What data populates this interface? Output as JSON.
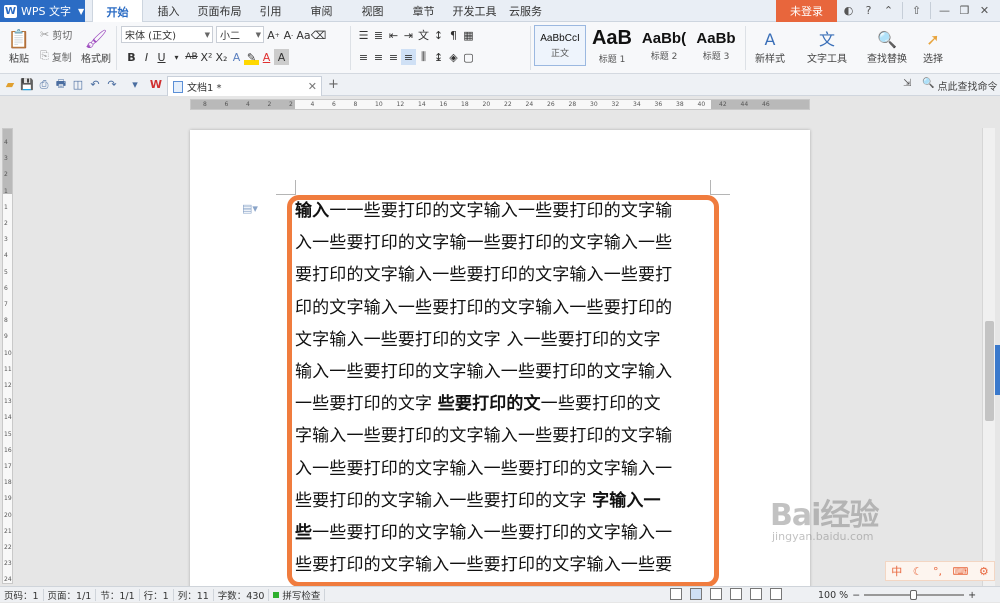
{
  "app": {
    "title": "WPS 文字"
  },
  "menu": {
    "tabs": [
      "开始",
      "插入",
      "页面布局",
      "引用",
      "审阅",
      "视图",
      "章节",
      "开发工具",
      "云服务"
    ],
    "active_index": 0,
    "login": "未登录"
  },
  "ribbon": {
    "paste": "粘贴",
    "cut": "剪切",
    "copy": "复制",
    "format_painter": "格式刷",
    "font_name": "宋体 (正文)",
    "font_size": "小二",
    "styles": [
      {
        "preview": "AaBbCcI",
        "name": "正文"
      },
      {
        "preview": "AaB",
        "name": "标题 1"
      },
      {
        "preview": "AaBb(",
        "name": "标题 2"
      },
      {
        "preview": "AaBb",
        "name": "标题 3"
      }
    ],
    "new_style": "新样式",
    "text_tools": "文字工具",
    "find_replace": "查找替换",
    "select": "选择"
  },
  "quickbar": {
    "doc_tab": "文档1 *",
    "find_command": "点此查找命令"
  },
  "ruler": {
    "h_ticks": [
      "8",
      "6",
      "4",
      "2",
      "2",
      "4",
      "6",
      "8",
      "10",
      "12",
      "14",
      "16",
      "18",
      "20",
      "22",
      "24",
      "26",
      "28",
      "30",
      "32",
      "34",
      "36",
      "38",
      "40",
      "42",
      "44",
      "46"
    ],
    "v_ticks": [
      "4",
      "3",
      "2",
      "1",
      "1",
      "2",
      "3",
      "4",
      "5",
      "6",
      "7",
      "8",
      "9",
      "10",
      "11",
      "12",
      "13",
      "14",
      "15",
      "16",
      "17",
      "18",
      "19",
      "20",
      "21",
      "22",
      "23",
      "24"
    ]
  },
  "document": {
    "lines": [
      [
        {
          "t": "输入",
          "b": true
        },
        {
          "t": "一一些要打印的文字输入一些要打印的文字输"
        }
      ],
      [
        {
          "t": "入一些要打印的文字输一些要打印的文字输入一些"
        }
      ],
      [
        {
          "t": "要打印的文字输入一些要打印的文字输入一些要打"
        }
      ],
      [
        {
          "t": "印的文字输入一些要打印的文字输入一些要打印的"
        }
      ],
      [
        {
          "t": "文字输入一些要打印的文字 入一些要打印的文字"
        }
      ],
      [
        {
          "t": "输入一些要打印的文字输入一些要打印的文字输入"
        }
      ],
      [
        {
          "t": "一些要打印的文字 "
        },
        {
          "t": "些要打印的文",
          "b": true
        },
        {
          "t": "一些要打印的文"
        }
      ],
      [
        {
          "t": "字输入一些要打印的文字输入一些要打印的文字输"
        }
      ],
      [
        {
          "t": "入一些要打印的文字输入一些要打印的文字输入一"
        }
      ],
      [
        {
          "t": "些要打印的文字输入一些要打印的文字 "
        },
        {
          "t": "字输入一",
          "b": true
        }
      ],
      [
        {
          "t": "些",
          "b": true
        },
        {
          "t": "一些要打印的文字输入一些要打印的文字输入一"
        }
      ],
      [
        {
          "t": "些要打印的文字输入一些要打印的文字输入一些要"
        }
      ]
    ]
  },
  "status": {
    "page_num": "页码：1",
    "pages": "页面：1/1",
    "section": "节：1/1",
    "row": "行：1",
    "col": "列：11",
    "word_count": "字数：430",
    "spell_check": "拼写检查",
    "zoom": "100 %"
  },
  "watermark": {
    "logo": "Bai经验",
    "sub": "jingyan.baidu.com"
  },
  "colors": {
    "accent": "#2b6cc4",
    "login": "#e8663c",
    "highlight": "#f07c3e"
  }
}
